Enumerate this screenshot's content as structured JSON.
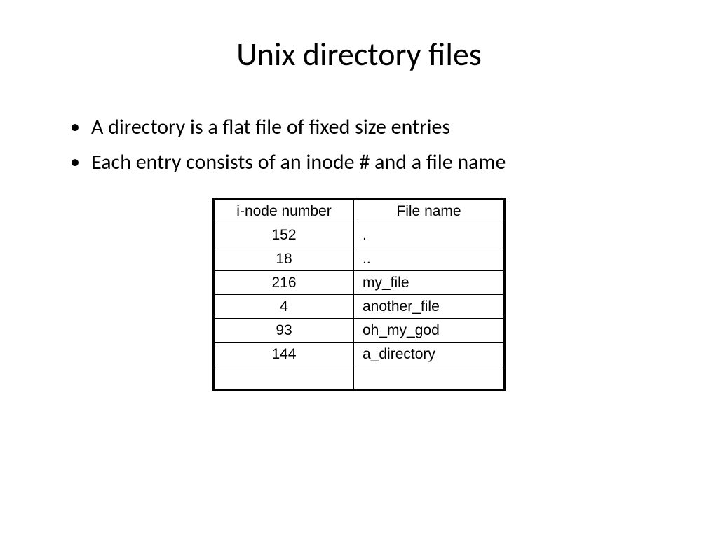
{
  "title": "Unix directory files",
  "bullets": [
    "A directory is a flat file of fixed size entries",
    "Each entry consists of an inode # and a file name"
  ],
  "table": {
    "headers": {
      "inode": "i-node number",
      "fname": "File name"
    },
    "rows": [
      {
        "inode": "152",
        "fname": "."
      },
      {
        "inode": "18",
        "fname": ".."
      },
      {
        "inode": "216",
        "fname": "my_file"
      },
      {
        "inode": "4",
        "fname": "another_file"
      },
      {
        "inode": "93",
        "fname": "oh_my_god"
      },
      {
        "inode": "144",
        "fname": "a_directory"
      },
      {
        "inode": "",
        "fname": ""
      }
    ]
  }
}
